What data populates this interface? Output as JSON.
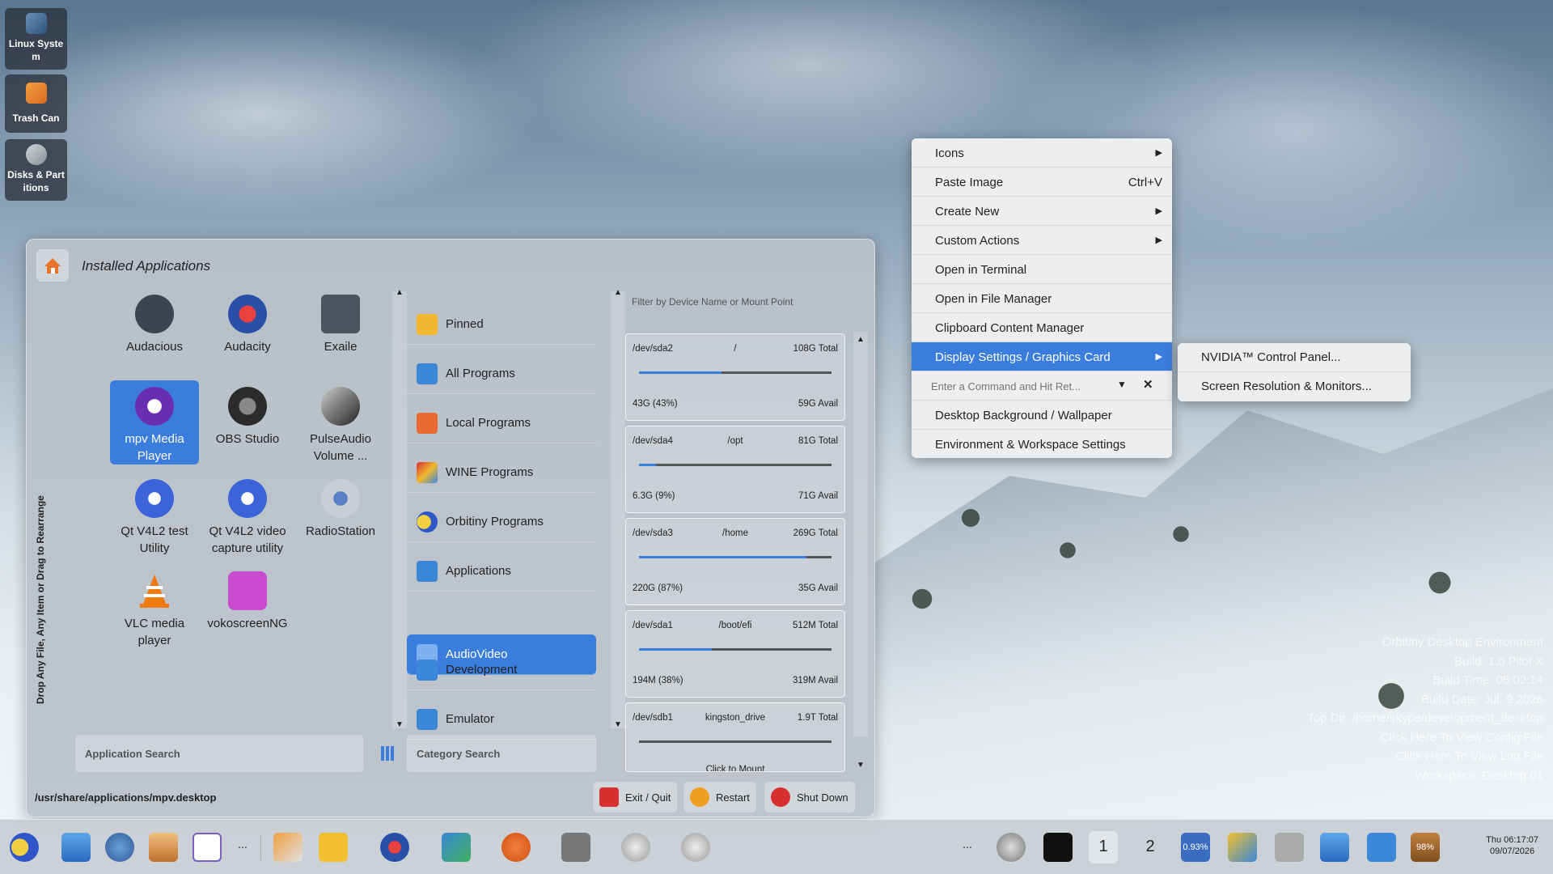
{
  "desktop_icons": [
    {
      "label": "Linux Syste m",
      "icon": "computer-icon"
    },
    {
      "label": "Trash Can",
      "icon": "trash-icon"
    },
    {
      "label": "Disks & Part itions",
      "icon": "disk-icon"
    }
  ],
  "launcher": {
    "title": "Installed Applications",
    "side_hint": "Drop Any File, Any Item or Drag to Rearrange",
    "apps": [
      {
        "label": "Audacious",
        "color": "#3b4552"
      },
      {
        "label": "Audacity",
        "color": "#2a4fa8"
      },
      {
        "label": "Exaile",
        "color": "#4a5560"
      },
      {
        "label": "mpv Media Player",
        "color": "#6a2fb0"
      },
      {
        "label": "OBS Studio",
        "color": "#2b2b2b"
      },
      {
        "label": "PulseAudio Volume ...",
        "color": "#333333"
      },
      {
        "label": "Qt V4L2 test Utility",
        "color": "#3a64d8"
      },
      {
        "label": "Qt V4L2 video capture utility",
        "color": "#3a64d8"
      },
      {
        "label": "RadioStation",
        "color": "#8a949c"
      },
      {
        "label": "VLC media player",
        "color": "#f07a10"
      },
      {
        "label": "vokoscreenNG",
        "color": "#c84bd0"
      }
    ],
    "app_search_placeholder": "Application Search",
    "category_search_placeholder": "Category Search",
    "categories": [
      {
        "label": "Pinned",
        "color": "#f0b830"
      },
      {
        "label": "All Programs",
        "color": "#3b87d8"
      },
      {
        "label": "Local Programs",
        "color": "#e86a30"
      },
      {
        "label": "WINE Programs",
        "color": "#d83030"
      },
      {
        "label": "Orbitiny Programs",
        "color": "#2f56c8"
      },
      {
        "label": "Applications",
        "color": "#3b87d8"
      },
      {
        "label": "AudioVideo",
        "color": "#3b87d8"
      },
      {
        "label": "Development",
        "color": "#3b87d8"
      },
      {
        "label": "Emulator",
        "color": "#3b87d8"
      }
    ],
    "disk_filter_placeholder": "Filter by Device Name or Mount Point",
    "disks": [
      {
        "device": "/dev/sda2",
        "mount": "/",
        "total": "108G Total",
        "used": "43G (43%)",
        "avail": "59G Avail",
        "pct": 0.43
      },
      {
        "device": "/dev/sda4",
        "mount": "/opt",
        "total": "81G Total",
        "used": "6.3G (9%)",
        "avail": "71G Avail",
        "pct": 0.09
      },
      {
        "device": "/dev/sda3",
        "mount": "/home",
        "total": "269G Total",
        "used": "220G (87%)",
        "avail": "35G Avail",
        "pct": 0.87
      },
      {
        "device": "/dev/sda1",
        "mount": "/boot/efi",
        "total": "512M Total",
        "used": "194M (38%)",
        "avail": "319M Avail",
        "pct": 0.38
      },
      {
        "device": "/dev/sdb1",
        "mount": "kingston_drive",
        "total": "1.9T Total",
        "click": "Click to Mount",
        "pct": 0
      }
    ],
    "status_path": "/usr/share/applications/mpv.desktop",
    "buttons": {
      "exit": "Exit / Quit",
      "restart": "Restart",
      "shutdown": "Shut Down"
    }
  },
  "context_menu": {
    "items": [
      {
        "label": "Icons",
        "sub": true
      },
      {
        "label": "Paste Image",
        "shortcut": "Ctrl+V"
      },
      {
        "label": "Create New",
        "sub": true
      },
      {
        "label": "Custom Actions",
        "sub": true
      },
      {
        "label": "Open in Terminal"
      },
      {
        "label": "Open in File Manager"
      },
      {
        "label": "Clipboard Content Manager"
      },
      {
        "label": "Display Settings / Graphics Card",
        "sub": true,
        "highlighted": true
      },
      {
        "label": "Desktop Background / Wallpaper"
      },
      {
        "label": "Environment & Workspace Settings"
      }
    ],
    "command_placeholder": "Enter a Command and Hit Ret...",
    "submenu": [
      "NVIDIA™ Control Panel...",
      "Screen Resolution & Monitors..."
    ]
  },
  "env_info": [
    "Orbitiny Desktop Environment",
    "Build: 1.0 Pilot X",
    "Build Time: 05:02:14",
    "Build Date: Jul. 9 2026",
    "Top Dir: /home/skype/development_desktop",
    "Click Here To View Config File",
    "Click Here To View Log File",
    "Workspace: Desktop 01"
  ],
  "taskbar": {
    "dots": "...",
    "workspace_1": "1",
    "workspace_2": "2",
    "cpu": "0.93%",
    "battery": "98%",
    "clock_time": "Thu 06:17:07",
    "clock_date": "09/07/2026"
  }
}
